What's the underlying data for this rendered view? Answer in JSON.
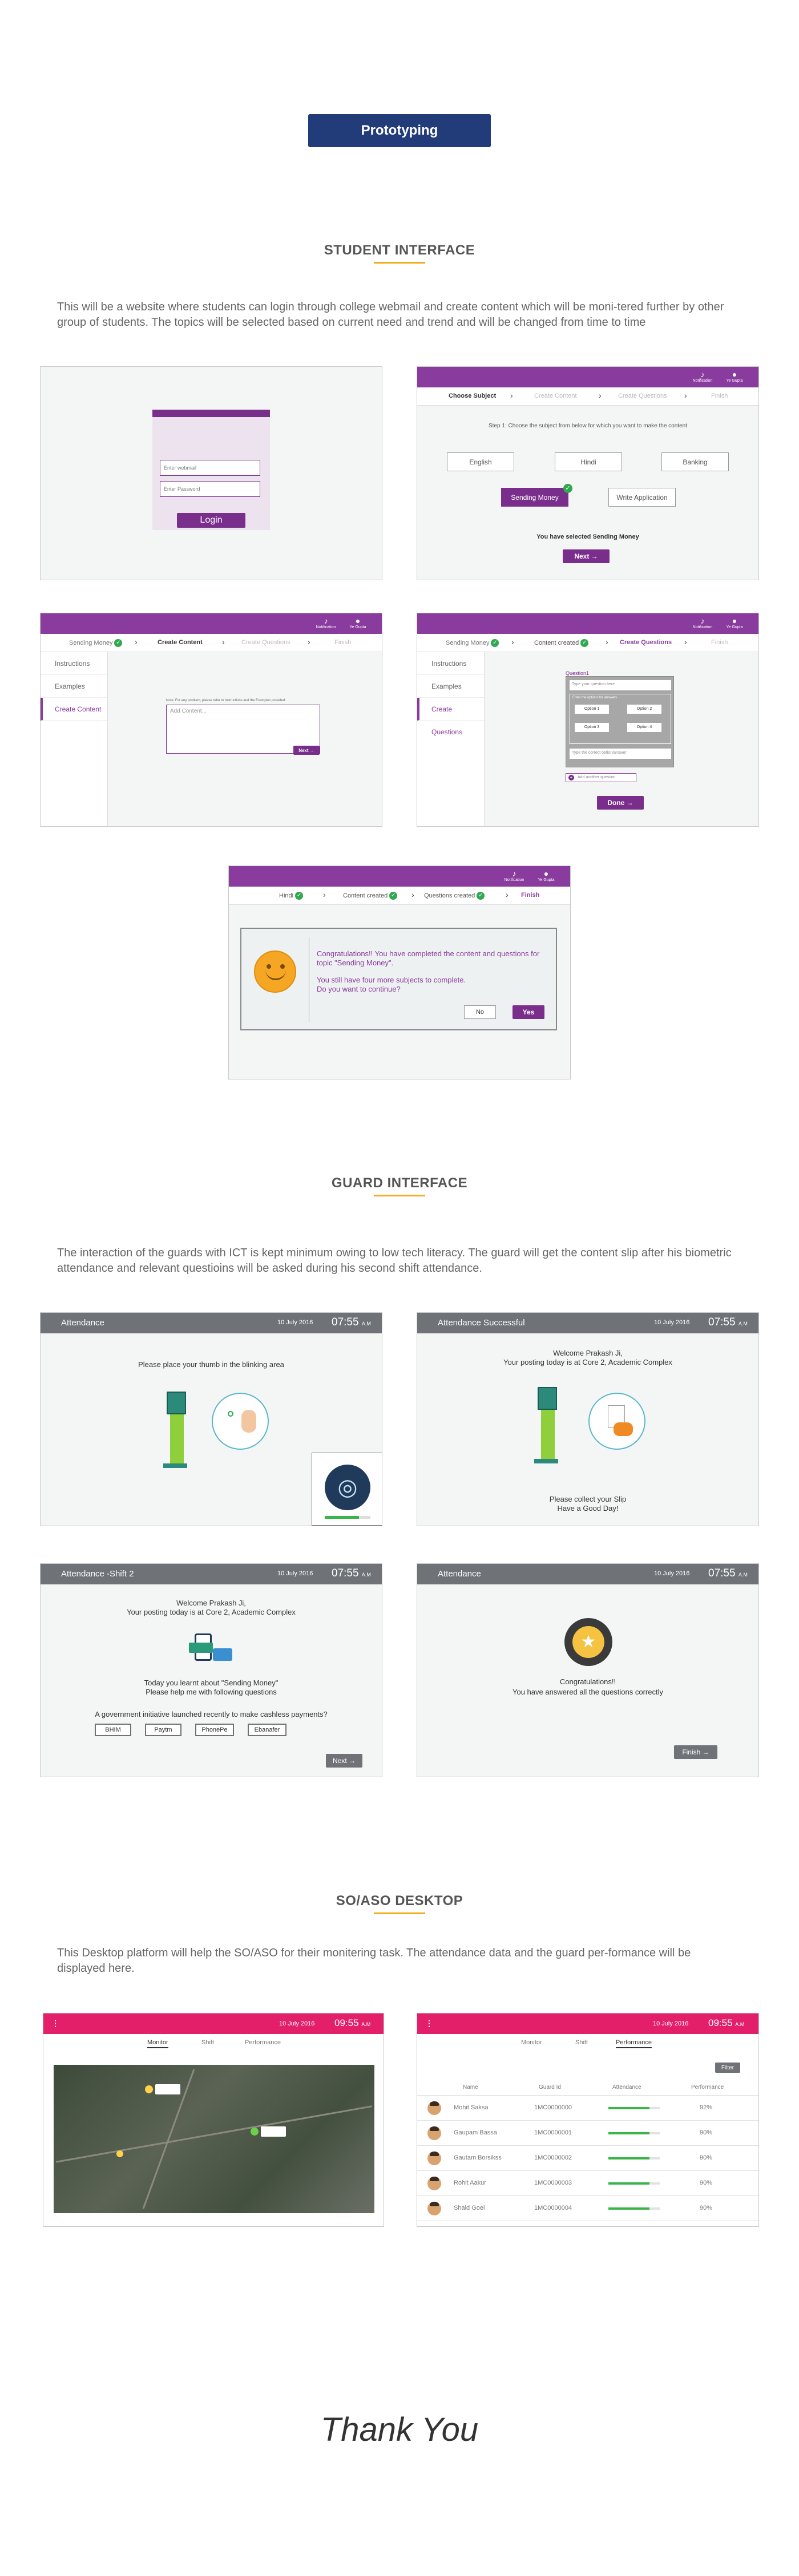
{
  "prototyping_label": "Prototyping",
  "student": {
    "title": "STUDENT INTERFACE",
    "description": "This will be a website where students can login through college webmail and create content which will be moni-tered further by other group of students. The topics will be selected based on current need and trend and will be changed from time to time",
    "login": {
      "webmail_placeholder": "Enter webmail",
      "password_placeholder": "Enter Password",
      "button": "Login"
    },
    "topbar": {
      "notification": "Notification",
      "user": "Ye Gupta"
    },
    "choose": {
      "steps": [
        "Choose Subject",
        "Create Content",
        "Create Questions",
        "Finish"
      ],
      "instruction": "Step 1: Choose the subject from below for which you want to make the content",
      "options": [
        "English",
        "Hindi",
        "Banking",
        "Sending Money",
        "Write Application"
      ],
      "selected_text": "You have selected Sending Money",
      "next": "Next"
    },
    "content": {
      "steps": [
        "Sending Money",
        "Create Content",
        "Create Questions",
        "Finish"
      ],
      "side": [
        "Instructions",
        "Examples",
        "Create Content"
      ],
      "note": "Note: For any problem, please refer to Instructions and the Examples provided",
      "placeholder": "Add Content...",
      "next": "Next"
    },
    "questions": {
      "steps": [
        "Sending Money",
        "Content created",
        "Create Questions",
        "Finish"
      ],
      "side": [
        "Instructions",
        "Examples",
        "Create Questions"
      ],
      "question_label": "Question1",
      "question_placeholder": "Type your question here",
      "options_label": "Enter the options for answers",
      "options": [
        "Option 1",
        "Option 2",
        "Option 3",
        "Option 4"
      ],
      "correct_placeholder": "Type the correct option/answer",
      "add": "Add another question",
      "done": "Done"
    },
    "finish": {
      "steps": [
        "Hindi",
        "Content created",
        "Questions created",
        "Finish"
      ],
      "message1": "Congratulations!! You have completed the content and questions for topic \"Sending Money\".",
      "message2": "You still have four more subjects to complete.",
      "message3": "Do you want to continue?",
      "no": "No",
      "yes": "Yes"
    }
  },
  "guard": {
    "title": "GUARD INTERFACE",
    "description": "The interaction of the guards with ICT is kept minimum owing to low tech literacy. The guard will get the content slip after his biometric attendance and relevant questioins will be asked during his second shift attendance.",
    "date": "10 July 2016",
    "time": "07:55",
    "ampm": "A.M",
    "s1": {
      "title": "Attendance",
      "text": "Please place your thumb in the blinking area"
    },
    "s2": {
      "title": "Attendance Successful",
      "welcome": "Welcome Prakash Ji,",
      "posting": "Your posting today is at Core 2, Academic Complex",
      "collect": "Please collect your Slip",
      "goodday": "Have a Good Day!"
    },
    "s3": {
      "title": "Attendance -Shift 2",
      "welcome": "Welcome Prakash Ji,",
      "posting": "Your posting today is at Core 2, Academic Complex",
      "learnt": "Today you learnt about \"Sending Money\"",
      "help": "Please help me with following questions",
      "question": "A government initiative launched recently to make cashless payments?",
      "options": [
        "BHIM",
        "Paytm",
        "PhonePe",
        "Ebanafer"
      ],
      "next": "Next"
    },
    "s4": {
      "title": "Attendance",
      "congrats": "Congratulations!!",
      "answered": "You have answered all the questions correctly",
      "finish": "Finish"
    }
  },
  "so": {
    "title": "SO/ASO DESKTOP",
    "description": "This Desktop platform will help the SO/ASO for their monitering task. The attendance data and the guard per-formance will be displayed here.",
    "date": "10 July 2016",
    "time": "09:55",
    "ampm": "A.M",
    "tabs": [
      "Monitor",
      "Shift",
      "Performance"
    ],
    "filter": "Filter",
    "columns": [
      "Name",
      "Guard Id",
      "Attendance",
      "Performance"
    ],
    "rows": [
      {
        "name": "Mohit Saksa",
        "id": "1MC0000000",
        "attendance": 0.8,
        "perf": "92%"
      },
      {
        "name": "Gaupam Bassa",
        "id": "1MC0000001",
        "attendance": 0.8,
        "perf": "90%"
      },
      {
        "name": "Gautam Borsikss",
        "id": "1MC0000002",
        "attendance": 0.8,
        "perf": "90%"
      },
      {
        "name": "Rohit Aakur",
        "id": "1MC0000003",
        "attendance": 0.8,
        "perf": "90%"
      },
      {
        "name": "Shald Goel",
        "id": "1MC0000004",
        "attendance": 0.8,
        "perf": "90%"
      }
    ]
  },
  "thank_you": "Thank You",
  "colors": {
    "purple": "#8a3c9e",
    "navy": "#223c7a",
    "accent": "#f0b01c",
    "pink": "#e31f6a",
    "gray": "#6f7378",
    "green": "#2fa84f"
  }
}
